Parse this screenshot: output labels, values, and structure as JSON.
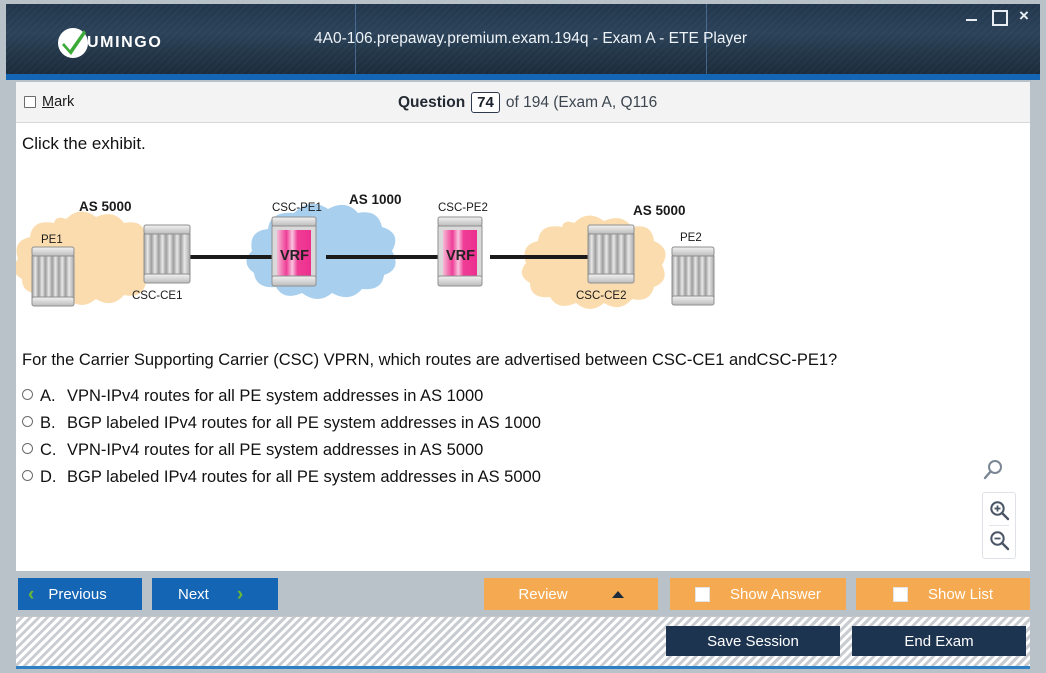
{
  "window": {
    "title": "4A0-106.prepaway.premium.exam.194q - Exam A - ETE Player",
    "logo_text": "UMINGO",
    "controls": {
      "minimize": "minimize-icon",
      "maximize": "maximize-icon",
      "close": "×"
    },
    "accent_color": "#1565b5",
    "titlebar_color": "#22374c"
  },
  "header": {
    "mark_label_pre": "",
    "mark_label_accel": "M",
    "mark_label_rest": "ark",
    "mark_checked": false,
    "question_word": "Question",
    "question_number": "74",
    "of_text": "of 194 (Exam A, Q116"
  },
  "content": {
    "prompt": "Click the exhibit.",
    "question": "For the Carrier Supporting Carrier (CSC) VPRN, which routes are advertised between CSC-CE1 andCSC-PE1?",
    "options": [
      {
        "letter": "A.",
        "text": "VPN-IPv4 routes for all PE system addresses in AS 1000",
        "selected": false
      },
      {
        "letter": "B.",
        "text": "BGP labeled IPv4 routes for all PE system addresses in AS 1000",
        "selected": false
      },
      {
        "letter": "C.",
        "text": "VPN-IPv4 routes for all PE system addresses in AS 5000",
        "selected": false
      },
      {
        "letter": "D.",
        "text": "BGP labeled IPv4 routes for all PE system addresses in AS 5000",
        "selected": false
      }
    ]
  },
  "exhibit": {
    "clouds": [
      {
        "label": "AS 5000",
        "color": "#fbdcae"
      },
      {
        "label": "AS 1000",
        "color": "#a8cfee"
      },
      {
        "label": "AS 5000",
        "color": "#fbdcae"
      }
    ],
    "nodes": [
      {
        "name": "PE1",
        "label_pos": "top",
        "type": "router"
      },
      {
        "name": "CSC-CE1",
        "label_pos": "bottom",
        "type": "router"
      },
      {
        "name": "CSC-PE1",
        "label_pos": "top",
        "type": "vrf-router",
        "body_label": "VRF"
      },
      {
        "name": "CSC-PE2",
        "label_pos": "top",
        "type": "vrf-router",
        "body_label": "VRF"
      },
      {
        "name": "CSC-CE2",
        "label_pos": "bottom",
        "type": "router"
      },
      {
        "name": "PE2",
        "label_pos": "top",
        "type": "router"
      }
    ],
    "vrf_color": "#ef3d96"
  },
  "magnifier": {
    "search_icon": "magnifier-icon",
    "zoom_in": "zoom-in-icon",
    "zoom_out": "zoom-out-icon"
  },
  "toolbar": {
    "previous": "Previous",
    "next": "Next",
    "review": "Review",
    "show_answer": "Show Answer",
    "show_list": "Show List",
    "show_answer_checked": false,
    "show_list_checked": false,
    "save_session": "Save Session",
    "end_exam": "End Exam",
    "blue": "#1565b5",
    "orange": "#f5a950",
    "dark": "#1d3450"
  }
}
